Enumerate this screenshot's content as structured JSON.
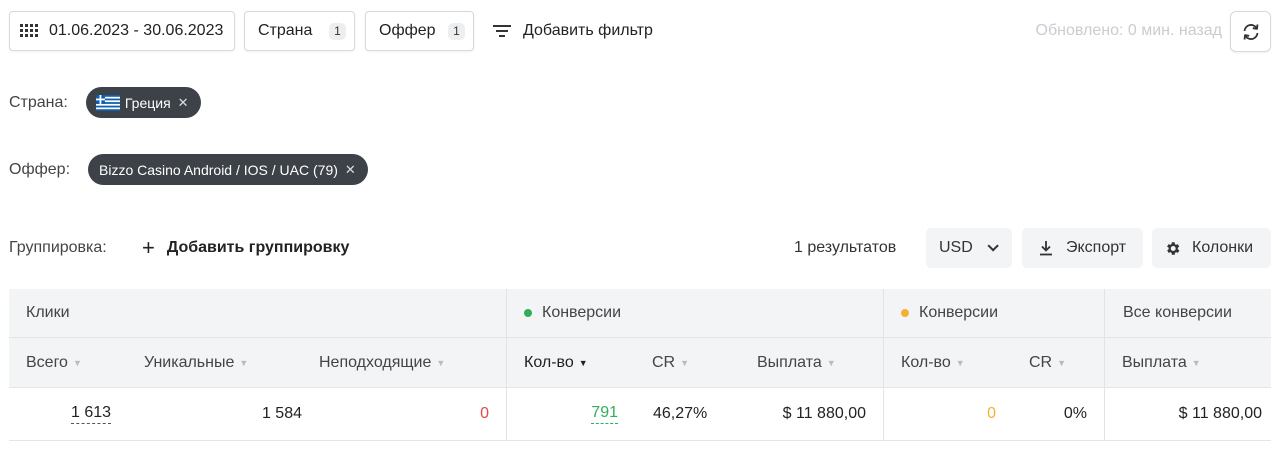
{
  "toolbar": {
    "date_range": "01.06.2023 - 30.06.2023",
    "country_label": "Страна",
    "country_count": "1",
    "offer_label": "Оффер",
    "offer_count": "1",
    "add_filter_label": "Добавить фильтр",
    "updated_text": "Обновлено: 0 мин. назад"
  },
  "filters": {
    "country_label": "Страна:",
    "country_chip": "Греция",
    "offer_label": "Оффер:",
    "offer_chip": "Bizzo Casino Android / IOS / UAC (79)"
  },
  "grouping": {
    "label": "Группировка:",
    "add_label": "Добавить группировку",
    "results_text": "1 результатов",
    "currency": "USD",
    "export_label": "Экспорт",
    "columns_label": "Колонки"
  },
  "table": {
    "groups": {
      "clicks": "Клики",
      "conv1": "Конверсии",
      "conv2": "Конверсии",
      "all": "Все конверсии"
    },
    "columns": {
      "total": "Всего",
      "unique": "Уникальные",
      "unsuitable": "Неподходящие",
      "qty1": "Кол-во",
      "cr1": "CR",
      "payout1": "Выплата",
      "qty2": "Кол-во",
      "cr2": "CR",
      "payout_all": "Выплата"
    },
    "row": {
      "total": "1 613",
      "unique": "1 584",
      "unsuitable": "0",
      "qty1": "791",
      "cr1": "46,27%",
      "payout1": "$ 11 880,00",
      "qty2": "0",
      "cr2": "0%",
      "payout_all": "$ 11 880,00"
    }
  },
  "colors": {
    "green_dot": "#2fae5b",
    "orange_dot": "#f2b134",
    "red_value": "#e5484d",
    "green_value": "#2fae5b",
    "orange_value": "#f2b134",
    "chip_bg": "#3d4248"
  }
}
